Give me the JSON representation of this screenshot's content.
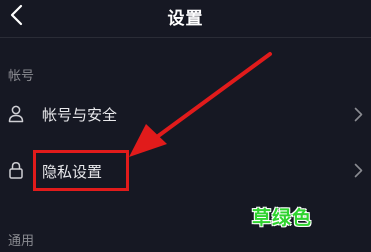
{
  "header": {
    "title": "设置",
    "back_icon": "chevron-left-icon"
  },
  "sections": [
    {
      "label": "帐号",
      "items": [
        {
          "label": "帐号与安全",
          "icon": "person-icon",
          "chevron": "chevron-right-icon"
        },
        {
          "label": "隐私设置",
          "icon": "lock-icon",
          "chevron": "chevron-right-icon",
          "highlighted": true
        }
      ]
    },
    {
      "label": "通用",
      "items": []
    }
  ],
  "annotation": {
    "highlight_color": "#e11b1b",
    "arrow_color": "#e11b1b"
  },
  "watermark": {
    "text": "草绿色",
    "color": "#2fd32f"
  },
  "colors": {
    "background": "#161823",
    "primary_text": "#ffffff",
    "secondary_text": "#8a8b91"
  }
}
